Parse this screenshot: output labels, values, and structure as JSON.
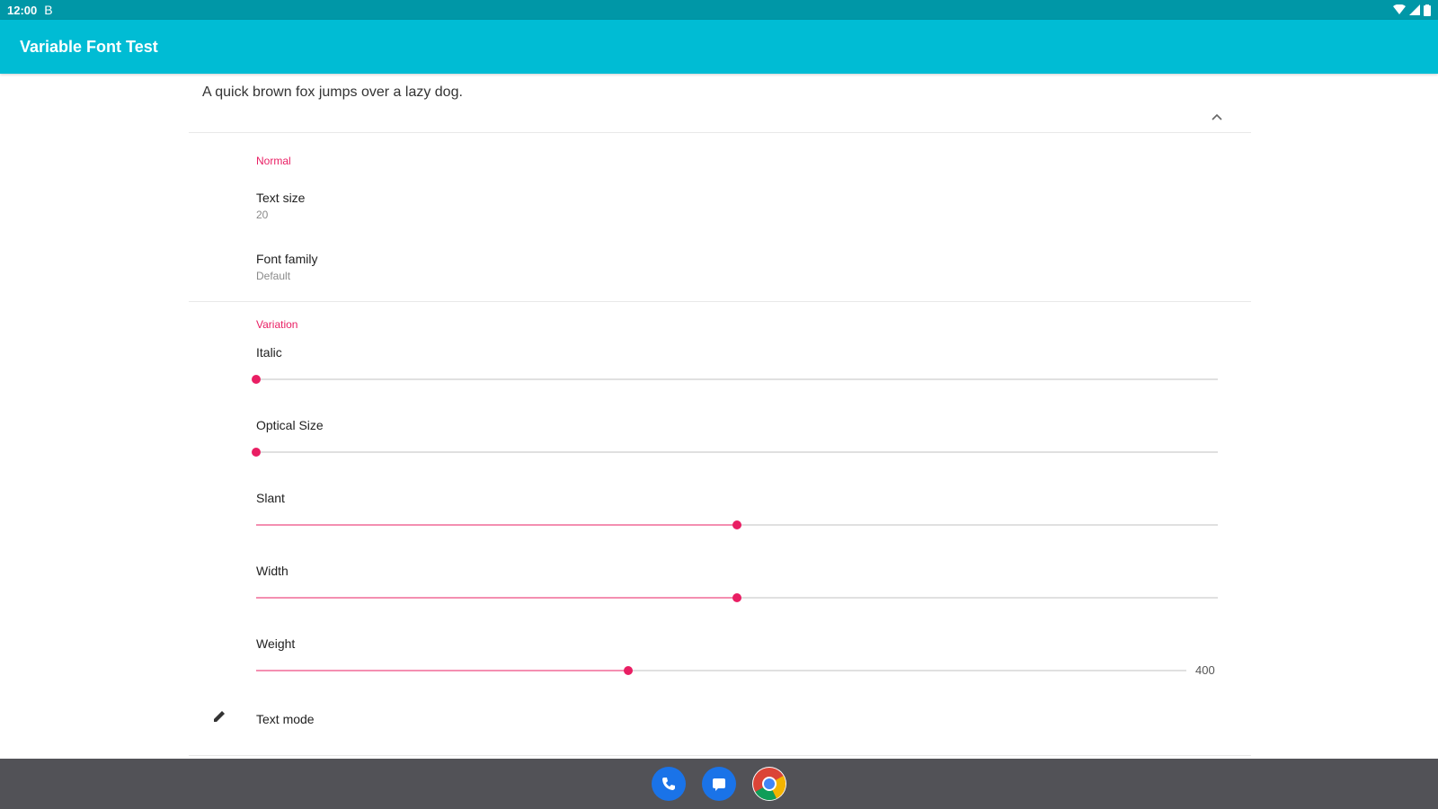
{
  "status": {
    "time": "12:00",
    "extra": "B"
  },
  "app_bar": {
    "title": "Variable Font Test"
  },
  "preview": {
    "text": "A quick brown fox jumps over a lazy dog."
  },
  "normal": {
    "category": "Normal",
    "text_size_title": "Text size",
    "text_size_value": "20",
    "font_family_title": "Font family",
    "font_family_value": "Default"
  },
  "variation": {
    "category": "Variation",
    "sliders": [
      {
        "label": "Italic",
        "level": 0.0
      },
      {
        "label": "Optical Size",
        "level": 0.0
      },
      {
        "label": "Slant",
        "level": 0.5
      },
      {
        "label": "Width",
        "level": 0.5
      },
      {
        "label": "Weight",
        "level": 0.4,
        "value": "400"
      }
    ]
  },
  "text_mode": {
    "label": "Text mode"
  },
  "colors": {
    "accent": "#e91e63",
    "primary": "#00bcd4",
    "primary_dark": "#0097a7"
  },
  "dock": [
    "phone-icon",
    "messages-icon",
    "chrome-icon"
  ]
}
